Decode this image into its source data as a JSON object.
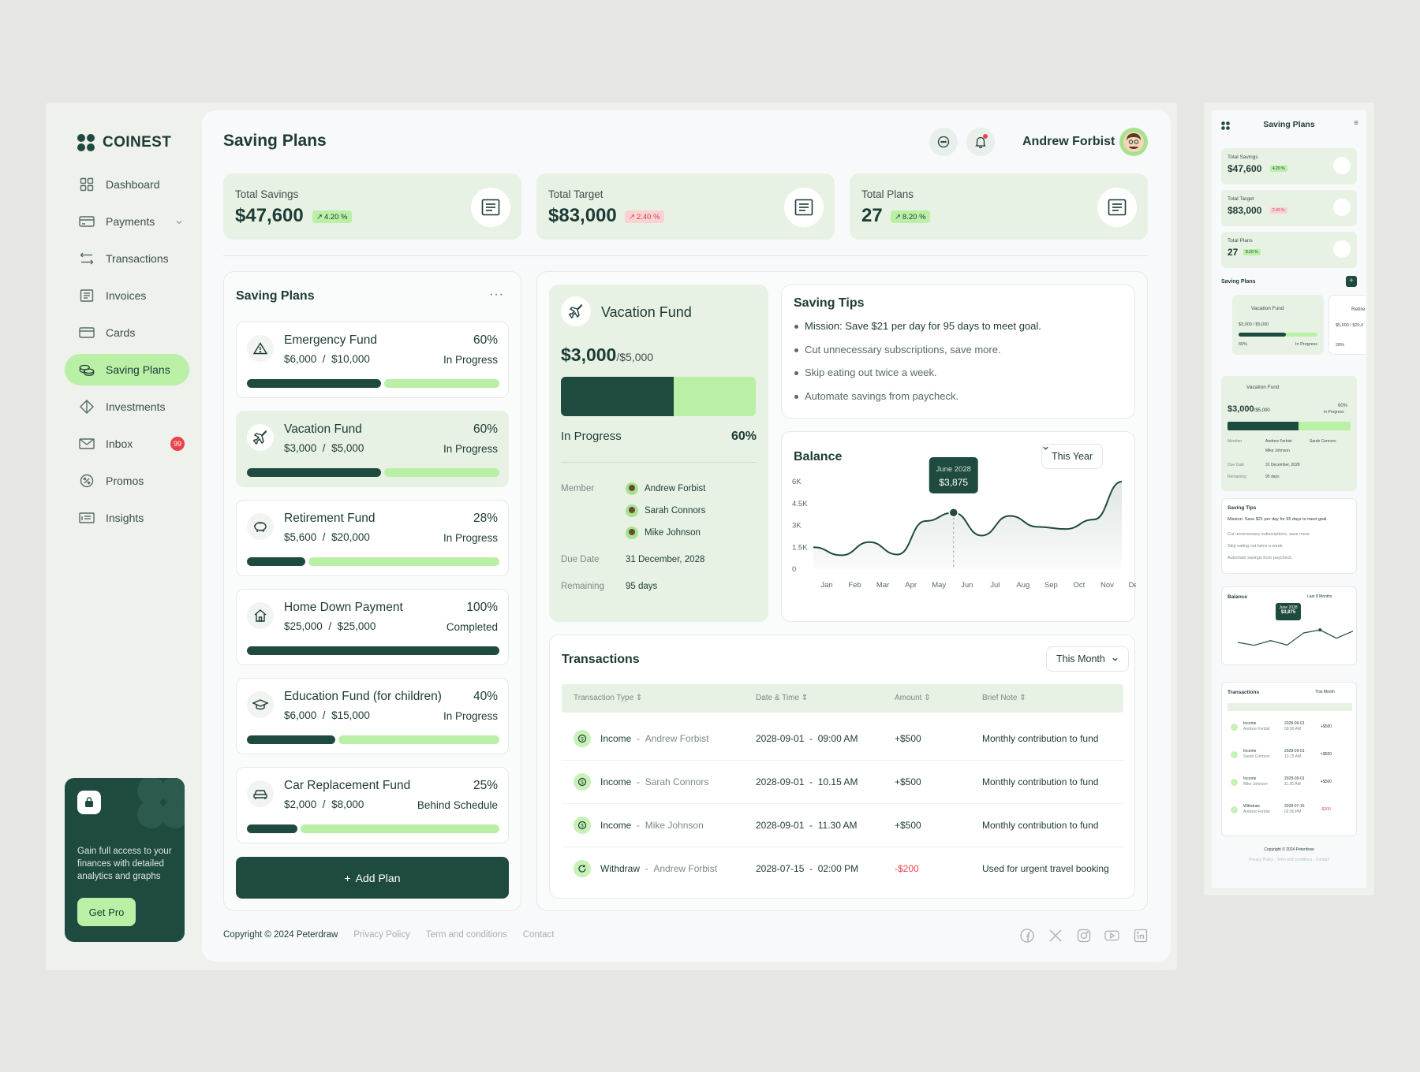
{
  "brand": {
    "name": "COINEST"
  },
  "sidebar": {
    "items": [
      {
        "label": "Dashboard",
        "icon": "grid-icon"
      },
      {
        "label": "Payments",
        "icon": "wallet-icon"
      },
      {
        "label": "Transactions",
        "icon": "swap-icon"
      },
      {
        "label": "Invoices",
        "icon": "invoice-icon"
      },
      {
        "label": "Cards",
        "icon": "card-icon"
      },
      {
        "label": "Saving Plans",
        "icon": "coins-icon"
      },
      {
        "label": "Investments",
        "icon": "diamond-icon"
      },
      {
        "label": "Inbox",
        "icon": "mail-icon",
        "badge": "99"
      },
      {
        "label": "Promos",
        "icon": "promo-icon"
      },
      {
        "label": "Insights",
        "icon": "insights-icon"
      }
    ],
    "promo": {
      "text": "Gain full access to your finances with detailed analytics and graphs",
      "button": "Get Pro"
    }
  },
  "header": {
    "title": "Saving Plans",
    "user_name": "Andrew Forbist"
  },
  "stats": [
    {
      "label": "Total Savings",
      "value": "$47,600",
      "change": "4.20 %",
      "trend": "up"
    },
    {
      "label": "Total Target",
      "value": "$83,000",
      "change": "2.40 %",
      "trend": "down"
    },
    {
      "label": "Total Plans",
      "value": "27",
      "change": "8.20 %",
      "trend": "up"
    }
  ],
  "plans": {
    "title": "Saving Plans",
    "more": "···",
    "items": [
      {
        "name": "Emergency Fund",
        "saved": "$6,000",
        "target": "$10,000",
        "percent": "60%",
        "status": "In Progress",
        "progress": 0.53,
        "icon": "warning-icon"
      },
      {
        "name": "Vacation Fund",
        "saved": "$3,000",
        "target": "$5,000",
        "percent": "60%",
        "status": "In Progress",
        "progress": 0.53,
        "icon": "plane-icon"
      },
      {
        "name": "Retirement Fund",
        "saved": "$5,600",
        "target": "$20,000",
        "percent": "28%",
        "status": "In Progress",
        "progress": 0.23,
        "icon": "piggy-icon"
      },
      {
        "name": "Home Down Payment",
        "saved": "$25,000",
        "target": "$25,000",
        "percent": "100%",
        "status": "Completed",
        "progress": 1.0,
        "icon": "home-icon"
      },
      {
        "name": "Education Fund (for children)",
        "saved": "$6,000",
        "target": "$15,000",
        "percent": "40%",
        "status": "In Progress",
        "progress": 0.35,
        "icon": "graduation-icon"
      },
      {
        "name": "Car Replacement Fund",
        "saved": "$2,000",
        "target": "$8,000",
        "percent": "25%",
        "status": "Behind Schedule",
        "progress": 0.2,
        "icon": "car-icon"
      }
    ],
    "add_label": "Add Plan"
  },
  "vacation": {
    "title": "Vacation Fund",
    "amount": "$3,000",
    "target": "/$5,000",
    "progress": 0.58,
    "status": "In Progress",
    "percent": "60%",
    "member_label": "Member",
    "members": [
      "Andrew Forbist",
      "Sarah Connors",
      "Mike Johnson"
    ],
    "due_label": "Due Date",
    "due_value": "31 December, 2028",
    "remaining_label": "Remaining",
    "remaining_value": "95 days"
  },
  "tips": {
    "title": "Saving Tips",
    "items": [
      "Mission: Save $21 per day for 95 days to meet goal.",
      "Cut unnecessary subscriptions, save more.",
      "Skip eating out twice a week.",
      "Automate savings from paycheck."
    ]
  },
  "balance": {
    "title": "Balance",
    "range": "This Year",
    "tooltip": {
      "label": "June 2028",
      "value": "$3,875"
    }
  },
  "chart_data": {
    "type": "area",
    "title": "Balance",
    "x": [
      "Jan",
      "Feb",
      "Mar",
      "Apr",
      "May",
      "Jun",
      "Jul",
      "Aug",
      "Sep",
      "Oct",
      "Nov",
      "Dec"
    ],
    "values": [
      1500,
      950,
      1850,
      1000,
      3300,
      3875,
      2300,
      3650,
      2900,
      2750,
      3400,
      6000
    ],
    "yticks": [
      "0",
      "1.5K",
      "3K",
      "4.5K",
      "6K"
    ],
    "ylim": [
      0,
      6000
    ],
    "highlight": "Jun"
  },
  "transactions": {
    "title": "Transactions",
    "range": "This Month",
    "columns": [
      "Transaction Type",
      "Date & Time",
      "Amount",
      "Brief Note"
    ],
    "rows": [
      {
        "type": "Income",
        "name": "Andrew Forbist",
        "date": "2028-09-01",
        "time": "09:00 AM",
        "amount": "+$500",
        "note": "Monthly contribution to fund"
      },
      {
        "type": "Income",
        "name": "Sarah Connors",
        "date": "2028-09-01",
        "time": "10.15 AM",
        "amount": "+$500",
        "note": "Monthly contribution to fund"
      },
      {
        "type": "Income",
        "name": "Mike Johnson",
        "date": "2028-09-01",
        "time": "11.30 AM",
        "amount": "+$500",
        "note": "Monthly contribution to fund"
      },
      {
        "type": "Withdraw",
        "name": "Andrew Forbist",
        "date": "2028-07-15",
        "time": "02:00 PM",
        "amount": "-$200",
        "note": "Used for urgent travel booking"
      }
    ]
  },
  "footer": {
    "copyright": "Copyright © 2024 Peterdraw",
    "links": [
      "Privacy Policy",
      "Term and conditions",
      "Contact"
    ]
  },
  "mobile": {
    "title": "Saving Plans",
    "plans_title": "Saving Plans",
    "vac_title": "Vacation Fund",
    "ret_title": "Retire",
    "vac_amount": "$3,000 / $5,000",
    "ret_amount": "$5,600 / $20,0",
    "vac_pct": "60%",
    "ret_pct": "28%",
    "vac_status": "In Progress",
    "detail_amount": "$3,000",
    "detail_target": "/$5,000",
    "detail_pct": "60%",
    "detail_status": "In Progress",
    "tips_title": "Saving Tips",
    "tips_items": [
      "Mission: Save $21 per day for 95 days to meet goal.",
      "Cut unnecessary subscriptions, save more.",
      "Skip eating out twice a week.",
      "Automate savings from paycheck."
    ],
    "balance_title": "Balance",
    "balance_range": "Last 8 Months",
    "balance_tip_label": "June 2028",
    "balance_tip_value": "$3,875",
    "tx_title": "Transactions",
    "tx_range": "This Month",
    "tx_rows": [
      {
        "type": "Income",
        "name": "Andrew Forbist",
        "date": "2028-09-01",
        "time": "09:00 AM",
        "amount": "+$500"
      },
      {
        "type": "Income",
        "name": "Sarah Connors",
        "date": "2028-09-01",
        "time": "10.15 AM",
        "amount": "+$500"
      },
      {
        "type": "Income",
        "name": "Mike Johnson",
        "date": "2028-09-01",
        "time": "11.30 AM",
        "amount": "+$500"
      },
      {
        "type": "Withdraw",
        "name": "Andrew Forbist",
        "date": "2028-07-15",
        "time": "02:00 PM",
        "amount": "-$200"
      }
    ],
    "copyright": "Copyright © 2024 Peterdraw",
    "links": "Privacy Policy · Term and conditions · Contact"
  },
  "colors": {
    "primary": "#1f4a40",
    "accent": "#b9f0a6",
    "card": "#e8f2e4",
    "danger": "#e8454b"
  }
}
